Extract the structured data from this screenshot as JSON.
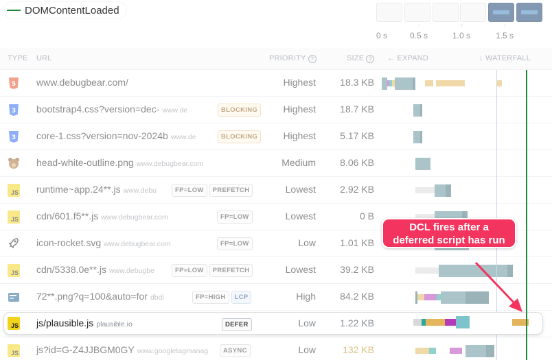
{
  "legend": {
    "label": "DOMContentLoaded",
    "color": "#1e8a3a"
  },
  "timeline": {
    "ticks": [
      "0 s",
      "0.5 s",
      "1.0 s",
      "1.5 s"
    ]
  },
  "header": {
    "type": "TYPE",
    "url": "URL",
    "priority": "PRIORITY",
    "size": "SIZE",
    "expand": "← EXPAND",
    "waterfall": "↓ WATERFALL",
    "help_glyph": "?"
  },
  "requests": [
    {
      "type": "html",
      "name": "www.debugbear.com/",
      "domain": "",
      "badges": [],
      "priority": "Highest",
      "size": "18.3 KB"
    },
    {
      "type": "css",
      "name": "bootstrap4.css?version=dec-",
      "domain": "www.de",
      "badges": [
        "BLOCKING"
      ],
      "priority": "Highest",
      "size": "18.7 KB"
    },
    {
      "type": "css",
      "name": "core-1.css?version=nov-2024b",
      "domain": "www.de",
      "badges": [
        "BLOCKING"
      ],
      "priority": "Highest",
      "size": "5.17 KB"
    },
    {
      "type": "image",
      "name": "head-white-outline.png",
      "domain": "www.debugbear.com",
      "badges": [],
      "priority": "Medium",
      "size": "8.06 KB"
    },
    {
      "type": "js",
      "name": "runtime~app.24**.js",
      "domain": "www.debu",
      "badges": [
        "FP=LOW",
        "PREFETCH"
      ],
      "priority": "Lowest",
      "size": "2.92 KB"
    },
    {
      "type": "js",
      "name": "cdn/601.f5**.js",
      "domain": "www.debugbear.com",
      "badges": [
        "FP=LOW"
      ],
      "priority": "Lowest",
      "size": "0 B"
    },
    {
      "type": "svg",
      "name": "icon-rocket.svg",
      "domain": "www.debugbear.com",
      "badges": [
        "FP=LOW"
      ],
      "priority": "Low",
      "size": "1.01 KB"
    },
    {
      "type": "js",
      "name": "cdn/5338.0e**.js",
      "domain": "www.debugbe",
      "badges": [
        "FP=LOW",
        "PREFETCH"
      ],
      "priority": "Lowest",
      "size": "39.2 KB"
    },
    {
      "type": "image",
      "name": "72**.png?q=100&auto=for",
      "domain": "dbdi",
      "badges": [
        "FP=HIGH",
        "LCP"
      ],
      "priority": "High",
      "size": "84.2 KB"
    },
    {
      "type": "js",
      "name": "js/plausible.js",
      "domain": "plausible.io",
      "badges": [
        "DEFER"
      ],
      "priority": "Low",
      "size": "1.22 KB"
    },
    {
      "type": "js",
      "name": "js?id=G-Z4JJBGM0GY",
      "domain": "www.googletagmanag",
      "badges": [
        "ASYNC"
      ],
      "priority": "Low",
      "size": "132 KB"
    }
  ],
  "callout": {
    "line1": "DCL fires after a",
    "line2": "deferred script has run"
  },
  "colors": {
    "accent": "#f3345e",
    "dcl": "#1e8a3a",
    "download": "#5e8f97",
    "wait": "#e3b45a",
    "js": "#b23cb8"
  }
}
